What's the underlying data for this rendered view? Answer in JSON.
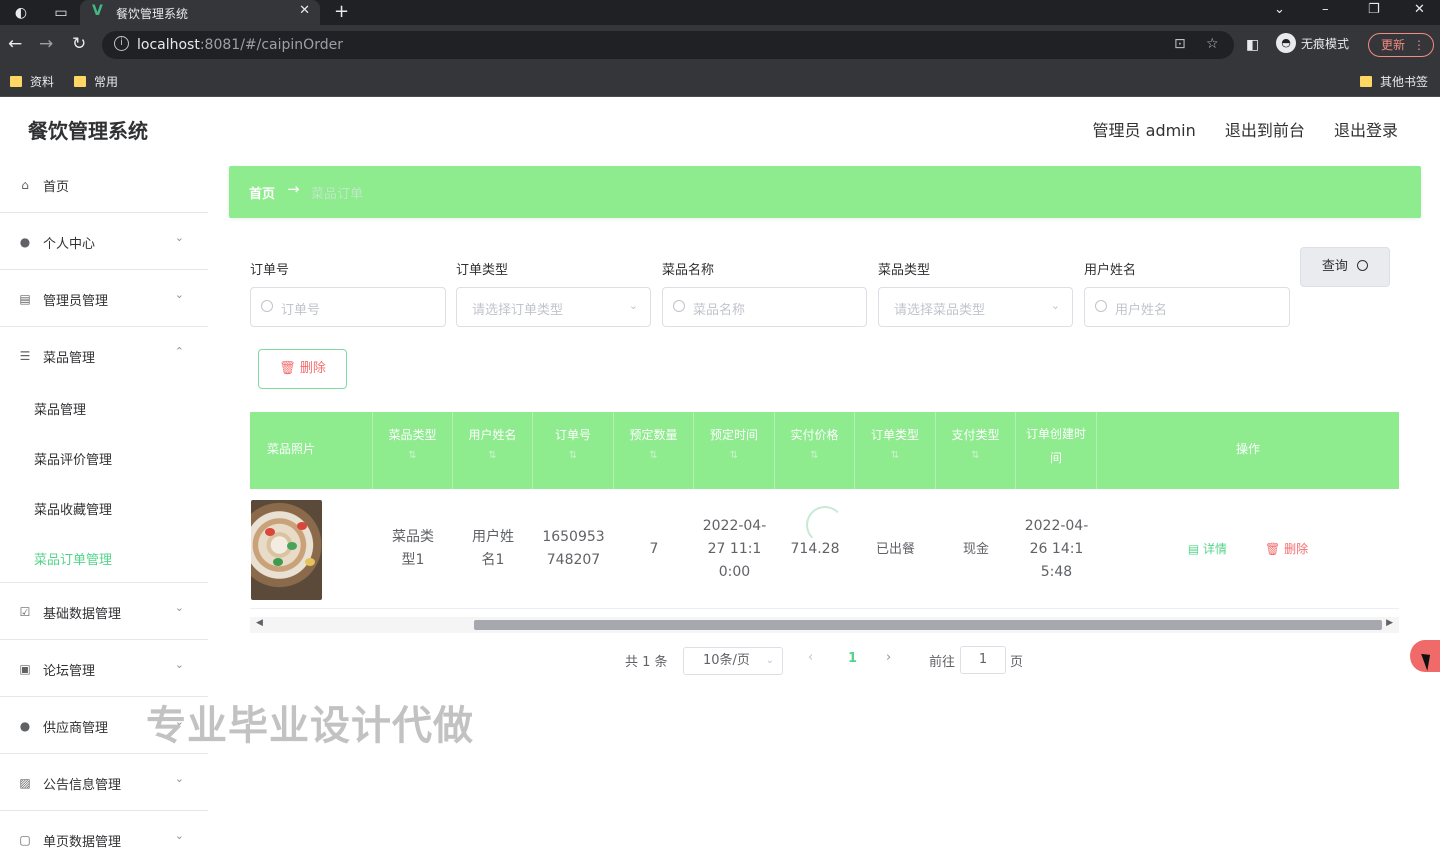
{
  "browser": {
    "tab_title": "餐饮管理系统",
    "url_host": "localhost",
    "url_rest": ":8081/#/caipinOrder",
    "incognito_label": "无痕模式",
    "update_label": "更新",
    "bookmarks": [
      "资料",
      "常用"
    ],
    "other_bookmarks": "其他书签"
  },
  "header": {
    "app_title": "餐饮管理系统",
    "user": "管理员 admin",
    "to_front": "退出到前台",
    "logout": "退出登录"
  },
  "sidebar": {
    "items": [
      {
        "label": "首页"
      },
      {
        "label": "个人中心"
      },
      {
        "label": "管理员管理"
      },
      {
        "label": "菜品管理"
      },
      {
        "label": "基础数据管理"
      },
      {
        "label": "论坛管理"
      },
      {
        "label": "供应商管理"
      },
      {
        "label": "公告信息管理"
      },
      {
        "label": "单页数据管理"
      }
    ],
    "sub_items": [
      {
        "label": "菜品管理"
      },
      {
        "label": "菜品评价管理"
      },
      {
        "label": "菜品收藏管理"
      },
      {
        "label": "菜品订单管理",
        "active": true
      }
    ]
  },
  "breadcrumb": {
    "home": "首页",
    "current": "菜品订单"
  },
  "search": {
    "order_no_label": "订单号",
    "order_no_placeholder": "订单号",
    "order_type_label": "订单类型",
    "order_type_placeholder": "请选择订单类型",
    "dish_name_label": "菜品名称",
    "dish_name_placeholder": "菜品名称",
    "dish_type_label": "菜品类型",
    "dish_type_placeholder": "请选择菜品类型",
    "user_name_label": "用户姓名",
    "user_name_placeholder": "用户姓名",
    "query_label": "查询"
  },
  "actions": {
    "delete_label": "删除"
  },
  "table": {
    "columns": [
      {
        "label": "菜品照片"
      },
      {
        "label": "菜品类型"
      },
      {
        "label": "用户姓名"
      },
      {
        "label": "订单号"
      },
      {
        "label": "预定数量"
      },
      {
        "label": "预定时间"
      },
      {
        "label": "实付价格"
      },
      {
        "label": "订单类型"
      },
      {
        "label": "支付类型"
      },
      {
        "label": "订单创建时间"
      },
      {
        "label": "操作"
      }
    ],
    "rows": [
      {
        "dish_type": "菜品类型1",
        "user_name": "用户姓名1",
        "order_no": "1650953748207",
        "quantity": "7",
        "reserve_time": "2022-04-27 11:10:00",
        "price": "714.28",
        "order_type": "已出餐",
        "pay_type": "现金",
        "create_time": "2022-04-26 14:15:48",
        "detail_label": "详情",
        "delete_label": "删除"
      }
    ]
  },
  "pagination": {
    "total": "共 1 条",
    "page_size": "10条/页",
    "current": "1",
    "goto": "前往",
    "goto_value": "1",
    "page_suffix": "页"
  },
  "watermark": "专业毕业设计代做"
}
